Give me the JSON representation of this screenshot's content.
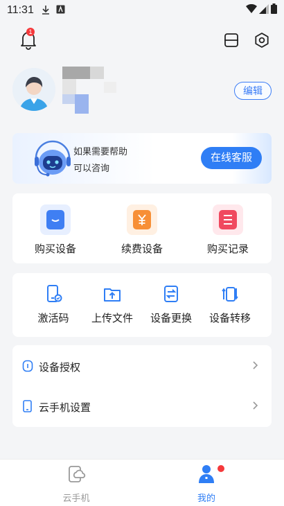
{
  "status_bar": {
    "time": "11:31"
  },
  "header": {
    "notification_count": "1"
  },
  "profile": {
    "edit_label": "编辑"
  },
  "help_card": {
    "line1": "如果需要帮助",
    "line2": "可以咨询",
    "button_label": "在线客服"
  },
  "purchase_actions": [
    {
      "label": "购买设备",
      "color": "#3f7ff3"
    },
    {
      "label": "续费设备",
      "color": "#f78f36"
    },
    {
      "label": "购买记录",
      "color": "#f0495f"
    }
  ],
  "tools": [
    {
      "label": "激活码",
      "icon": "activation-code-icon"
    },
    {
      "label": "上传文件",
      "icon": "upload-file-icon"
    },
    {
      "label": "设备更换",
      "icon": "device-replace-icon"
    },
    {
      "label": "设备转移",
      "icon": "device-transfer-icon"
    }
  ],
  "menu": [
    {
      "label": "设备授权",
      "icon": "authorization-icon"
    },
    {
      "label": "云手机设置",
      "icon": "phone-settings-icon"
    }
  ],
  "tabbar": {
    "tabs": [
      {
        "label": "云手机",
        "active": false
      },
      {
        "label": "我的",
        "active": true
      }
    ]
  },
  "colors": {
    "accent": "#2f7ef5",
    "inactive_tab": "#999999",
    "badge": "#f5393b"
  }
}
